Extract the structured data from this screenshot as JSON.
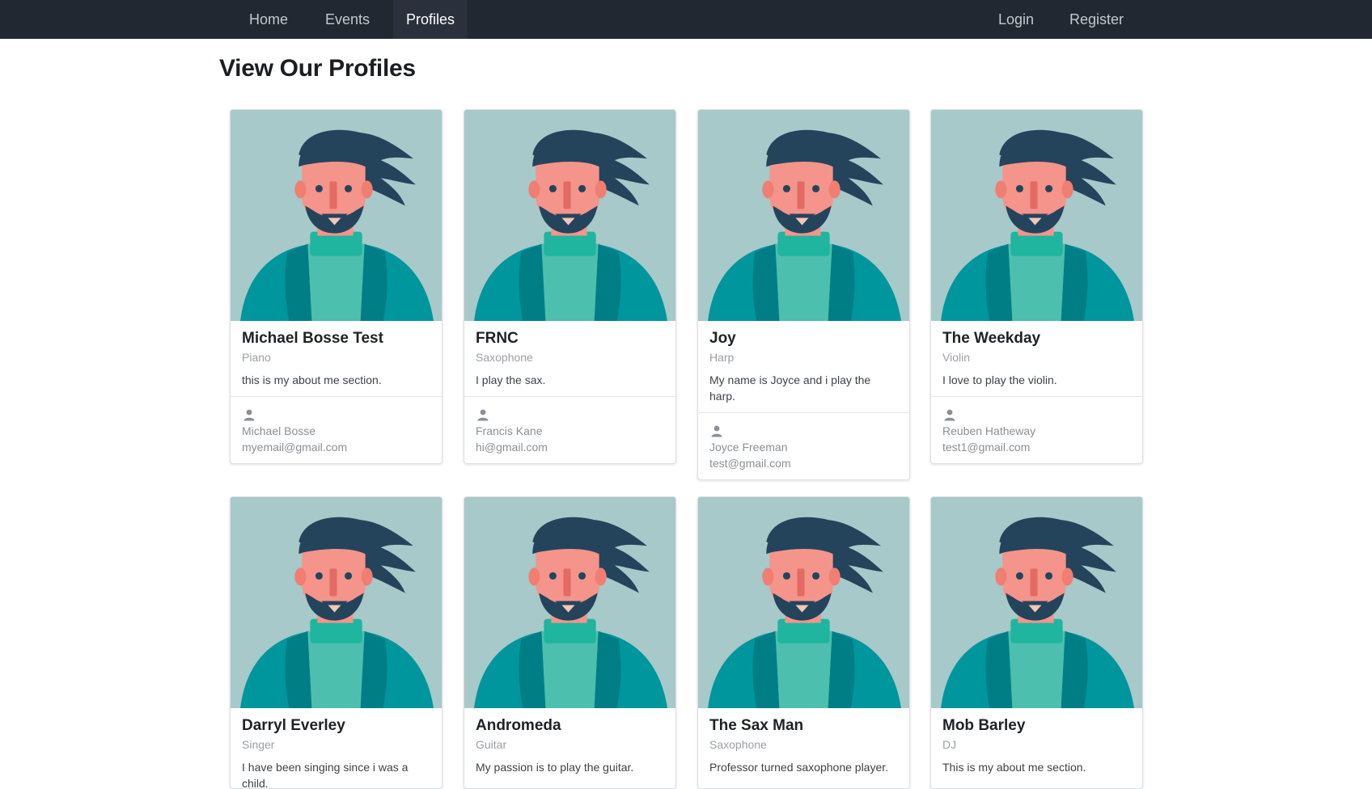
{
  "nav": {
    "home": "Home",
    "events": "Events",
    "profiles": "Profiles",
    "login": "Login",
    "register": "Register"
  },
  "page_title": "View Our Profiles",
  "profiles": [
    {
      "name": "Michael Bosse Test",
      "instrument": "Piano",
      "about": "this is my about me section.",
      "owner": "Michael Bosse",
      "email": "myemail@gmail.com"
    },
    {
      "name": "FRNC",
      "instrument": "Saxophone",
      "about": "I play the sax.",
      "owner": "Francis Kane",
      "email": "hi@gmail.com"
    },
    {
      "name": "Joy",
      "instrument": "Harp",
      "about": "My name is Joyce and i play the harp.",
      "owner": "Joyce Freeman",
      "email": "test@gmail.com"
    },
    {
      "name": "The Weekday",
      "instrument": "Violin",
      "about": "I love to play the violin.",
      "owner": "Reuben Hatheway",
      "email": "test1@gmail.com"
    },
    {
      "name": "Darryl Everley",
      "instrument": "Singer",
      "about": "I have been singing since i was a child.",
      "owner": "",
      "email": ""
    },
    {
      "name": "Andromeda",
      "instrument": "Guitar",
      "about": "My passion is to play the guitar.",
      "owner": "",
      "email": ""
    },
    {
      "name": "The Sax Man",
      "instrument": "Saxophone",
      "about": "Professor turned saxophone player.",
      "owner": "",
      "email": ""
    },
    {
      "name": "Mob Barley",
      "instrument": "DJ",
      "about": "This is my about me section.",
      "owner": "",
      "email": ""
    }
  ],
  "colors": {
    "navbar": "#222831",
    "avatar_bg": "#a7c9c9",
    "hair": "#24445c",
    "skin": "#f4948a",
    "shirt": "#4cbfae",
    "jacket": "#00969e"
  }
}
